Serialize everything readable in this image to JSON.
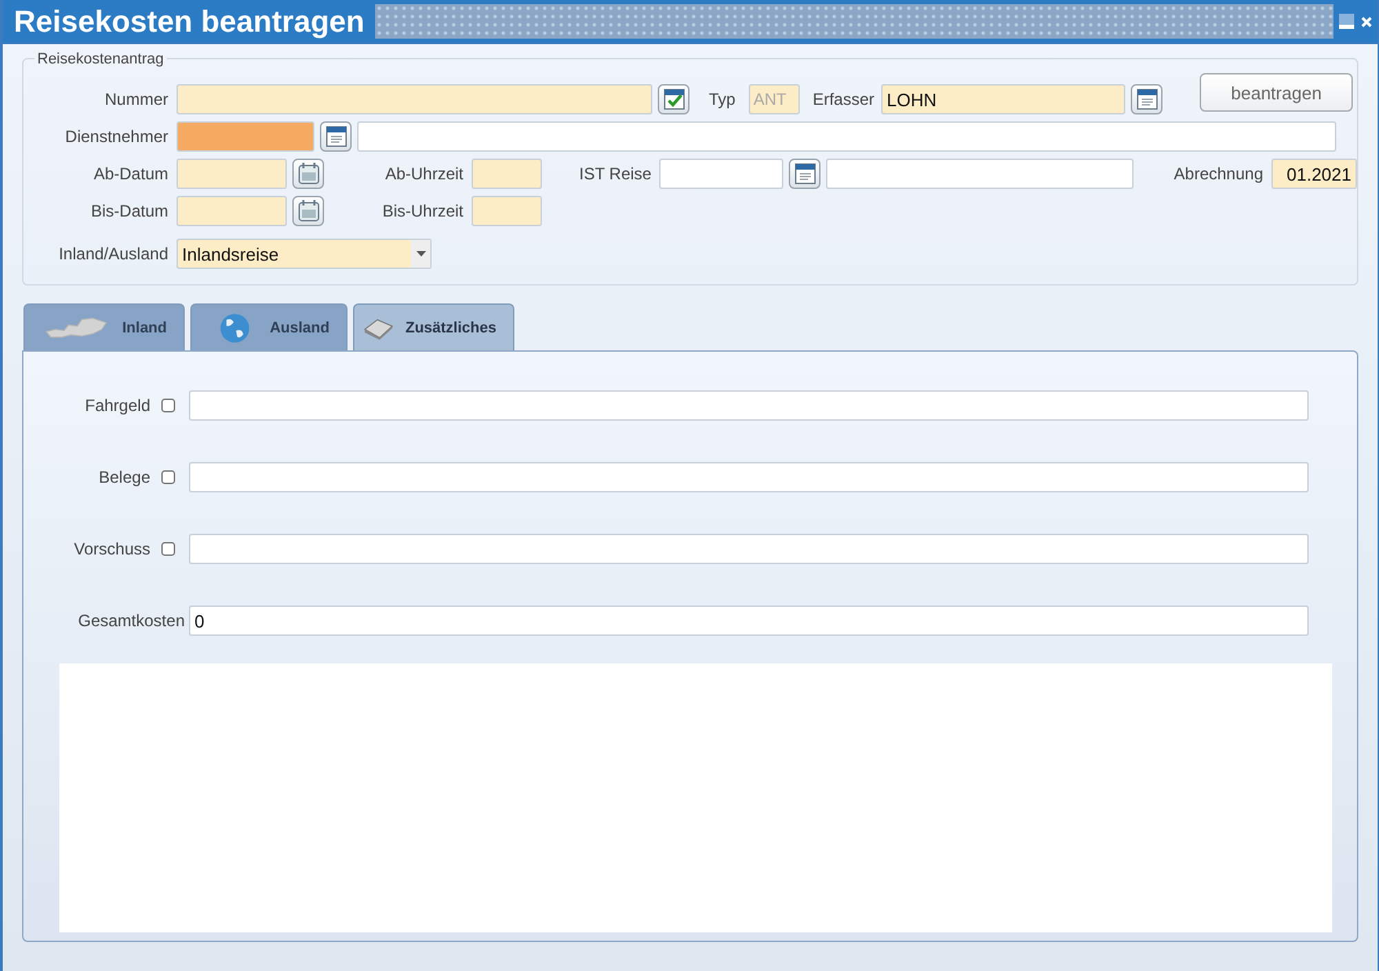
{
  "window": {
    "title": "Reisekosten beantragen"
  },
  "request": {
    "legend": "Reisekostenantrag",
    "number_label": "Nummer",
    "type_label": "Typ",
    "type": {
      "value": "ANT",
      "disabled": true
    },
    "recorder_label": "Erfasser",
    "recorder": "LOHN",
    "submit_button": "beantragen",
    "employee_label": "Dienstnehmer",
    "employee_field": {
      "highlighted": true
    },
    "from_date_label": "Ab-Datum",
    "from_time_label": "Ab-Uhrzeit",
    "actual_trip_label": "IST Reise",
    "billing_label": "Abrechnung",
    "billing": "01.2021",
    "to_date_label": "Bis-Datum",
    "to_time_label": "Bis-Uhrzeit",
    "region_label": "Inland/Ausland",
    "region": "Inlandsreise"
  },
  "tabs": [
    {
      "label": "Inland",
      "kind": "map",
      "selected": false
    },
    {
      "label": "Ausland",
      "kind": "globe",
      "selected": false
    },
    {
      "label": "Zusätzliches",
      "kind": "book",
      "selected": true
    }
  ],
  "extras": [
    {
      "label": "Fahrgeld",
      "kind": "check",
      "checked": false
    },
    {
      "label": "Belege",
      "kind": "check",
      "checked": false
    },
    {
      "label": "Vorschuss",
      "kind": "check",
      "checked": false
    },
    {
      "label": "Gesamtkosten",
      "kind": "total",
      "value": "0"
    }
  ]
}
